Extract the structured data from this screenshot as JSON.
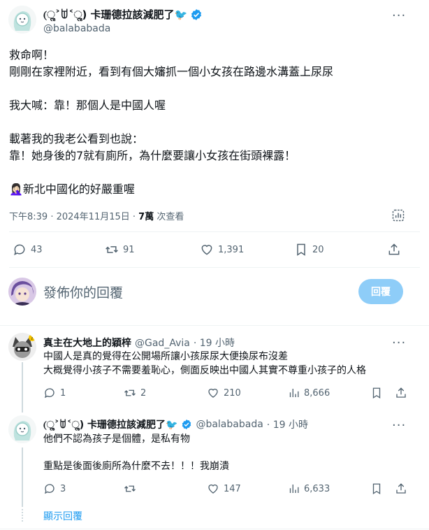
{
  "main": {
    "display_name": "(ૢ˃ꌂ˂ૢ) 卡珊德拉該減肥了🐦",
    "handle": "@balababada",
    "lines": [
      "救命啊！",
      "剛剛在家裡附近，看到有個大嬸抓一個小女孩在路邊水溝蓋上尿尿",
      "我大喊：靠！那個人是中國人喔",
      "載著我的我老公看到也說：",
      "靠！她身後的7就有廁所，為什麼要讓小女孩在街頭裸露！",
      "🤦🏻‍♀️新北中國化的好嚴重喔"
    ],
    "time": "下午8:39 · 2024年11月15日 · ",
    "views": "7萬",
    "views_label": " 次查看",
    "stats": {
      "replies": "43",
      "reposts": "91",
      "likes": "1,391",
      "bookmarks": "20"
    }
  },
  "reply_box": {
    "placeholder": "發佈你的回覆",
    "button": "回覆"
  },
  "replies": [
    {
      "display_name": "真主在大地上的穎梓",
      "handle": "@Gad_Avia",
      "time": "· 19 小時",
      "lines": [
        "中國人是真的覺得在公開場所讓小孩尿尿大便換尿布沒差",
        "大概覺得小孩子不需要羞恥心，側面反映出中國人其實不尊重小孩子的人格"
      ],
      "stats": {
        "replies": "1",
        "reposts": "2",
        "likes": "210",
        "views": "8,666"
      }
    },
    {
      "display_name": "(ૢ˃ꌂ˂ૢ) 卡珊德拉該減肥了🐦",
      "handle": "@balababada",
      "time": "· 19 小時",
      "lines": [
        "他們不認為孩子是個體，是私有物",
        "重點是後面後廁所為什麼不去！！！我崩潰"
      ],
      "stats": {
        "replies": "3",
        "reposts": "",
        "likes": "147",
        "views": "6,633"
      }
    }
  ],
  "show_more": "顯示回覆"
}
